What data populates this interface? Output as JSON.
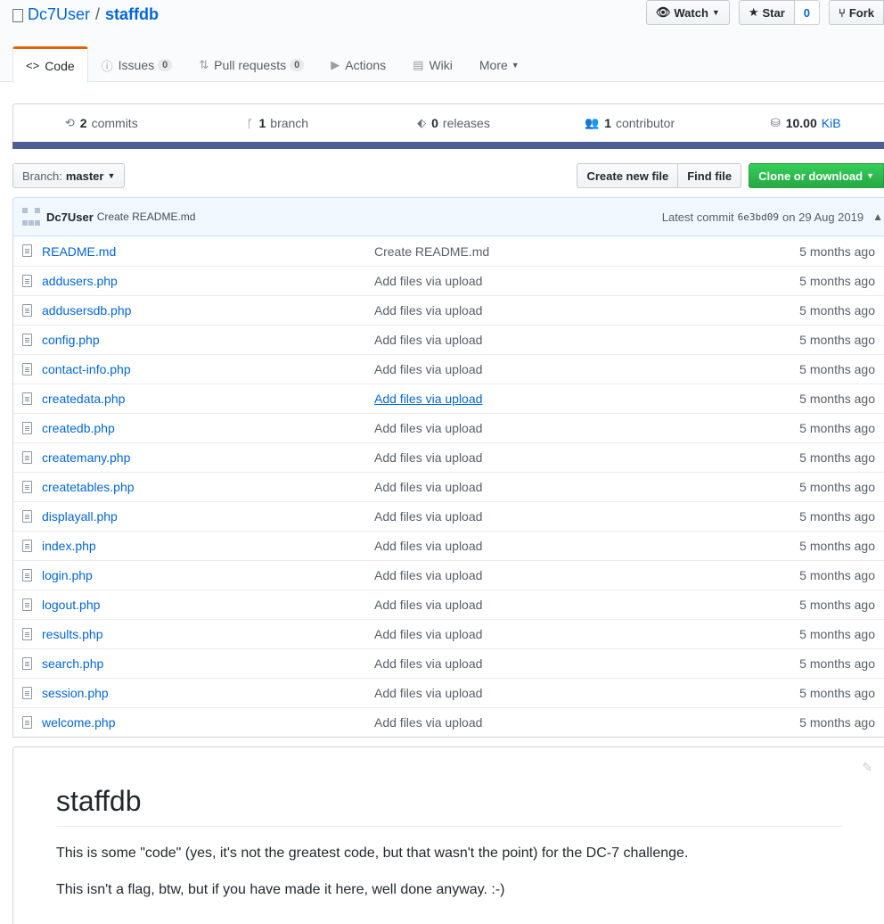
{
  "repo": {
    "owner": "Dc7User",
    "separator": "/",
    "name": "staffdb"
  },
  "actions": {
    "watch_label": "Watch",
    "star_label": "Star",
    "star_count": "0",
    "fork_label": "Fork"
  },
  "tabs": [
    {
      "label": "Code",
      "icon": "code-icon",
      "selected": true
    },
    {
      "label": "Issues",
      "badge": "0",
      "icon": "issue-icon"
    },
    {
      "label": "Pull requests",
      "badge": "0",
      "icon": "pull-request-icon"
    },
    {
      "label": "Actions",
      "icon": "play-icon"
    },
    {
      "label": "Wiki",
      "icon": "book-icon"
    },
    {
      "label": "More",
      "icon": "chevron-down-icon"
    }
  ],
  "summary": {
    "commits_num": "2",
    "commits_label": "commits",
    "branch_num": "1",
    "branch_label": "branch",
    "releases_num": "0",
    "releases_label": "releases",
    "contributor_num": "1",
    "contributor_label": "contributor",
    "size_num": "10.00",
    "size_unit": "KiB"
  },
  "language_color": "#4F5D95",
  "filenav": {
    "branch_label": "Branch:",
    "branch_value": "master",
    "create_file": "Create new file",
    "find_file": "Find file",
    "clone": "Clone or download"
  },
  "commit": {
    "author": "Dc7User",
    "message": "Create README.md",
    "latest_label": "Latest commit",
    "sha": "6e3bd09",
    "date": "on 29 Aug 2019"
  },
  "files": [
    {
      "name": "README.md",
      "message": "Create README.md",
      "age": "5 months ago"
    },
    {
      "name": "addusers.php",
      "message": "Add files via upload",
      "age": "5 months ago"
    },
    {
      "name": "addusersdb.php",
      "message": "Add files via upload",
      "age": "5 months ago"
    },
    {
      "name": "config.php",
      "message": "Add files via upload",
      "age": "5 months ago"
    },
    {
      "name": "contact-info.php",
      "message": "Add files via upload",
      "age": "5 months ago"
    },
    {
      "name": "createdata.php",
      "message": "Add files via upload",
      "age": "5 months ago"
    },
    {
      "name": "createdb.php",
      "message": "Add files via upload",
      "age": "5 months ago"
    },
    {
      "name": "createmany.php",
      "message": "Add files via upload",
      "age": "5 months ago"
    },
    {
      "name": "createtables.php",
      "message": "Add files via upload",
      "age": "5 months ago"
    },
    {
      "name": "displayall.php",
      "message": "Add files via upload",
      "age": "5 months ago"
    },
    {
      "name": "index.php",
      "message": "Add files via upload",
      "age": "5 months ago"
    },
    {
      "name": "login.php",
      "message": "Add files via upload",
      "age": "5 months ago"
    },
    {
      "name": "logout.php",
      "message": "Add files via upload",
      "age": "5 months ago"
    },
    {
      "name": "results.php",
      "message": "Add files via upload",
      "age": "5 months ago"
    },
    {
      "name": "search.php",
      "message": "Add files via upload",
      "age": "5 months ago"
    },
    {
      "name": "session.php",
      "message": "Add files via upload",
      "age": "5 months ago"
    },
    {
      "name": "welcome.php",
      "message": "Add files via upload",
      "age": "5 months ago"
    }
  ],
  "readme": {
    "title": "staffdb",
    "p1": "This is some \"code\" (yes, it's not the greatest code, but that wasn't the point) for the DC-7 challenge.",
    "p2": "This isn't a flag, btw, but if you have made it here, well done anyway. :-)"
  }
}
